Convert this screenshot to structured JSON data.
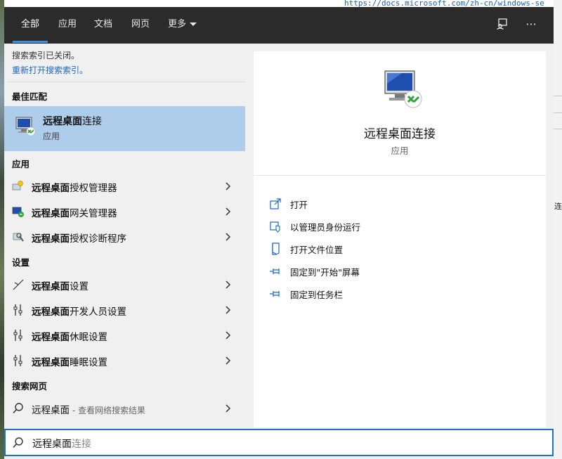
{
  "background": {
    "url_text": "https://docs.microsoft.com/zh-cn/windows-se",
    "right_edge_char": "连"
  },
  "tabs": [
    {
      "label": "全部",
      "active": true
    },
    {
      "label": "应用",
      "active": false
    },
    {
      "label": "文档",
      "active": false
    },
    {
      "label": "网页",
      "active": false
    },
    {
      "label": "更多",
      "active": false
    }
  ],
  "top_icons": [
    "feedback-icon",
    "more-options-icon"
  ],
  "top_more_glyph": "···",
  "notice": {
    "line1": "搜索索引已关闭。",
    "link": "重新打开搜索索引。"
  },
  "sections": {
    "best_match": "最佳匹配",
    "apps": "应用",
    "settings": "设置",
    "web": "搜索网页"
  },
  "best_match": {
    "title_bold": "远程桌面",
    "title_rest": "连接",
    "subtitle": "应用"
  },
  "apps": [
    {
      "bold": "远程桌面",
      "rest": "授权管理器",
      "icon": "license-manager-icon"
    },
    {
      "bold": "远程桌面",
      "rest": "网关管理器",
      "icon": "gateway-manager-icon"
    },
    {
      "bold": "远程桌面",
      "rest": "授权诊断程序",
      "icon": "license-diagnoser-icon"
    }
  ],
  "settings": [
    {
      "bold": "远程桌面",
      "rest": "设置",
      "icon": "remote-settings-icon"
    },
    {
      "bold": "远程桌面",
      "rest": "开发人员设置",
      "icon": "developer-settings-icon"
    },
    {
      "bold": "远程桌面",
      "rest": "休眠设置",
      "icon": "hibernate-settings-icon"
    },
    {
      "bold": "远程桌面",
      "rest": "睡眠设置",
      "icon": "sleep-settings-icon"
    }
  ],
  "web": {
    "query": "远程桌面",
    "suffix": " - 查看网络搜索结果"
  },
  "detail": {
    "title": "远程桌面连接",
    "subtitle": "应用",
    "actions": [
      {
        "label": "打开",
        "icon": "open-icon"
      },
      {
        "label": "以管理员身份运行",
        "icon": "run-as-admin-icon"
      },
      {
        "label": "打开文件位置",
        "icon": "file-location-icon"
      },
      {
        "label": "固定到\"开始\"屏幕",
        "icon": "pin-start-icon"
      },
      {
        "label": "固定到任务栏",
        "icon": "pin-taskbar-icon"
      }
    ]
  },
  "search": {
    "typed": "远程桌面",
    "autocomplete": "连接"
  },
  "colors": {
    "accent": "#1a73c8",
    "highlight": "#adcdea",
    "topbar": "#2b2b2b"
  }
}
